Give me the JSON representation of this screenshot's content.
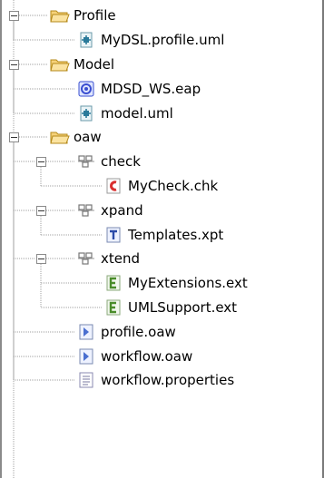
{
  "tree": {
    "items": [
      {
        "label": "Profile",
        "level": 0,
        "icon": "folder-icon",
        "expanded": true
      },
      {
        "label": "MyDSL.profile.uml",
        "level": 1,
        "icon": "uml-file-icon"
      },
      {
        "label": "Model",
        "level": 0,
        "icon": "folder-icon",
        "expanded": true
      },
      {
        "label": "MDSD_WS.eap",
        "level": 1,
        "icon": "eap-file-icon"
      },
      {
        "label": "model.uml",
        "level": 1,
        "icon": "uml-file-icon"
      },
      {
        "label": "oaw",
        "level": 0,
        "icon": "folder-icon",
        "expanded": true
      },
      {
        "label": "check",
        "level": 1,
        "icon": "package-icon",
        "expanded": true
      },
      {
        "label": "MyCheck.chk",
        "level": 2,
        "icon": "check-file-icon"
      },
      {
        "label": "xpand",
        "level": 1,
        "icon": "package-icon",
        "expanded": true
      },
      {
        "label": "Templates.xpt",
        "level": 2,
        "icon": "template-file-icon"
      },
      {
        "label": "xtend",
        "level": 1,
        "icon": "package-icon",
        "expanded": true
      },
      {
        "label": "MyExtensions.ext",
        "level": 2,
        "icon": "extension-file-icon"
      },
      {
        "label": "UMLSupport.ext",
        "level": 2,
        "icon": "extension-file-icon"
      },
      {
        "label": "profile.oaw",
        "level": 1,
        "icon": "workflow-file-icon"
      },
      {
        "label": "workflow.oaw",
        "level": 1,
        "icon": "workflow-file-icon"
      },
      {
        "label": "workflow.properties",
        "level": 1,
        "icon": "properties-file-icon"
      }
    ]
  },
  "colors": {
    "folder_fill": "#f6d27a",
    "folder_stroke": "#b58a1a",
    "uml_blue": "#2a7a9a",
    "eap_blue": "#3a4fd0",
    "check_red": "#d92f2f",
    "extension_green": "#4a8c2a",
    "workflow_blue": "#4a6fd0",
    "tree_line": "#a0a0a0"
  }
}
